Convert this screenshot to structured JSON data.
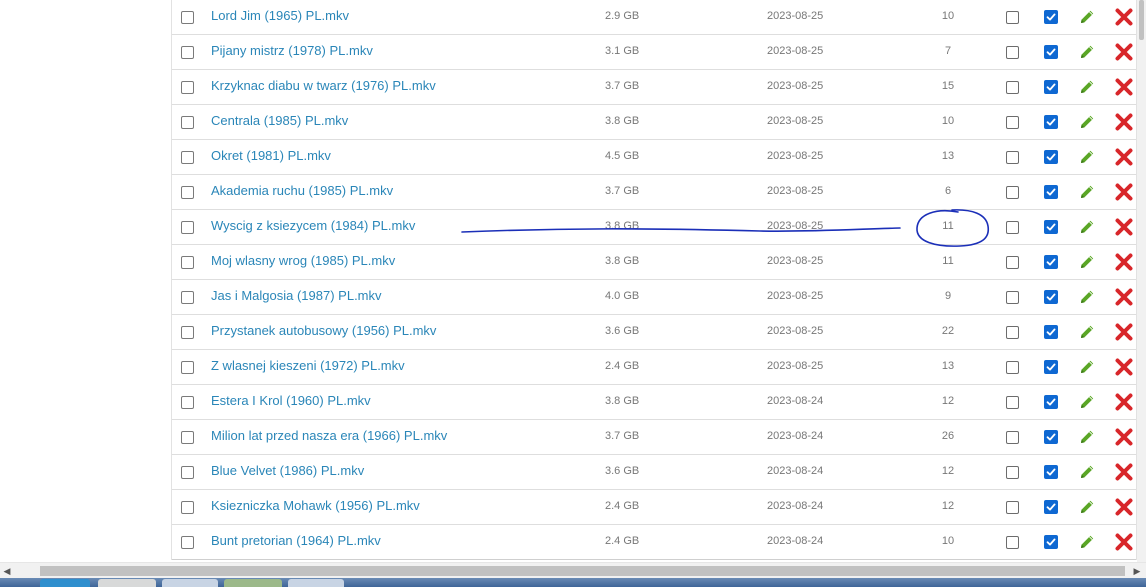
{
  "files": [
    {
      "name": "Lord Jim (1965) PL.mkv",
      "size": "2.9 GB",
      "date": "2023-08-25",
      "count": "10"
    },
    {
      "name": "Pijany mistrz (1978) PL.mkv",
      "size": "3.1 GB",
      "date": "2023-08-25",
      "count": "7"
    },
    {
      "name": "Krzyknac diabu w twarz (1976) PL.mkv",
      "size": "3.7 GB",
      "date": "2023-08-25",
      "count": "15"
    },
    {
      "name": "Centrala (1985) PL.mkv",
      "size": "3.8 GB",
      "date": "2023-08-25",
      "count": "10"
    },
    {
      "name": "Okret (1981) PL.mkv",
      "size": "4.5 GB",
      "date": "2023-08-25",
      "count": "13"
    },
    {
      "name": "Akademia ruchu (1985) PL.mkv",
      "size": "3.7 GB",
      "date": "2023-08-25",
      "count": "6"
    },
    {
      "name": "Wyscig z ksiezycem (1984) PL.mkv",
      "size": "3.8 GB",
      "date": "2023-08-25",
      "count": "11"
    },
    {
      "name": "Moj wlasny wrog (1985) PL.mkv",
      "size": "3.8 GB",
      "date": "2023-08-25",
      "count": "11"
    },
    {
      "name": "Jas i Malgosia (1987) PL.mkv",
      "size": "4.0 GB",
      "date": "2023-08-25",
      "count": "9"
    },
    {
      "name": "Przystanek autobusowy (1956) PL.mkv",
      "size": "3.6 GB",
      "date": "2023-08-25",
      "count": "22"
    },
    {
      "name": "Z wlasnej kieszeni (1972) PL.mkv",
      "size": "2.4 GB",
      "date": "2023-08-25",
      "count": "13"
    },
    {
      "name": "Estera I Krol (1960) PL.mkv",
      "size": "3.8 GB",
      "date": "2023-08-24",
      "count": "12"
    },
    {
      "name": "Milion lat przed nasza era (1966) PL.mkv",
      "size": "3.7 GB",
      "date": "2023-08-24",
      "count": "26"
    },
    {
      "name": "Blue Velvet (1986) PL.mkv",
      "size": "3.6 GB",
      "date": "2023-08-24",
      "count": "12"
    },
    {
      "name": "Ksiezniczka Mohawk (1956) PL.mkv",
      "size": "2.4 GB",
      "date": "2023-08-24",
      "count": "12"
    },
    {
      "name": "Bunt pretorian (1964) PL.mkv",
      "size": "2.4 GB",
      "date": "2023-08-24",
      "count": "10"
    }
  ],
  "icons": {
    "edit": "pencil-icon",
    "delete": "red-x-icon",
    "checked": "checkmark-icon"
  },
  "colors": {
    "link": "#2a86b8",
    "checked_box": "#0e68d2",
    "edit_icon": "#5aa626",
    "delete_icon": "#d8262a",
    "annotation": "#1b2fb8"
  }
}
